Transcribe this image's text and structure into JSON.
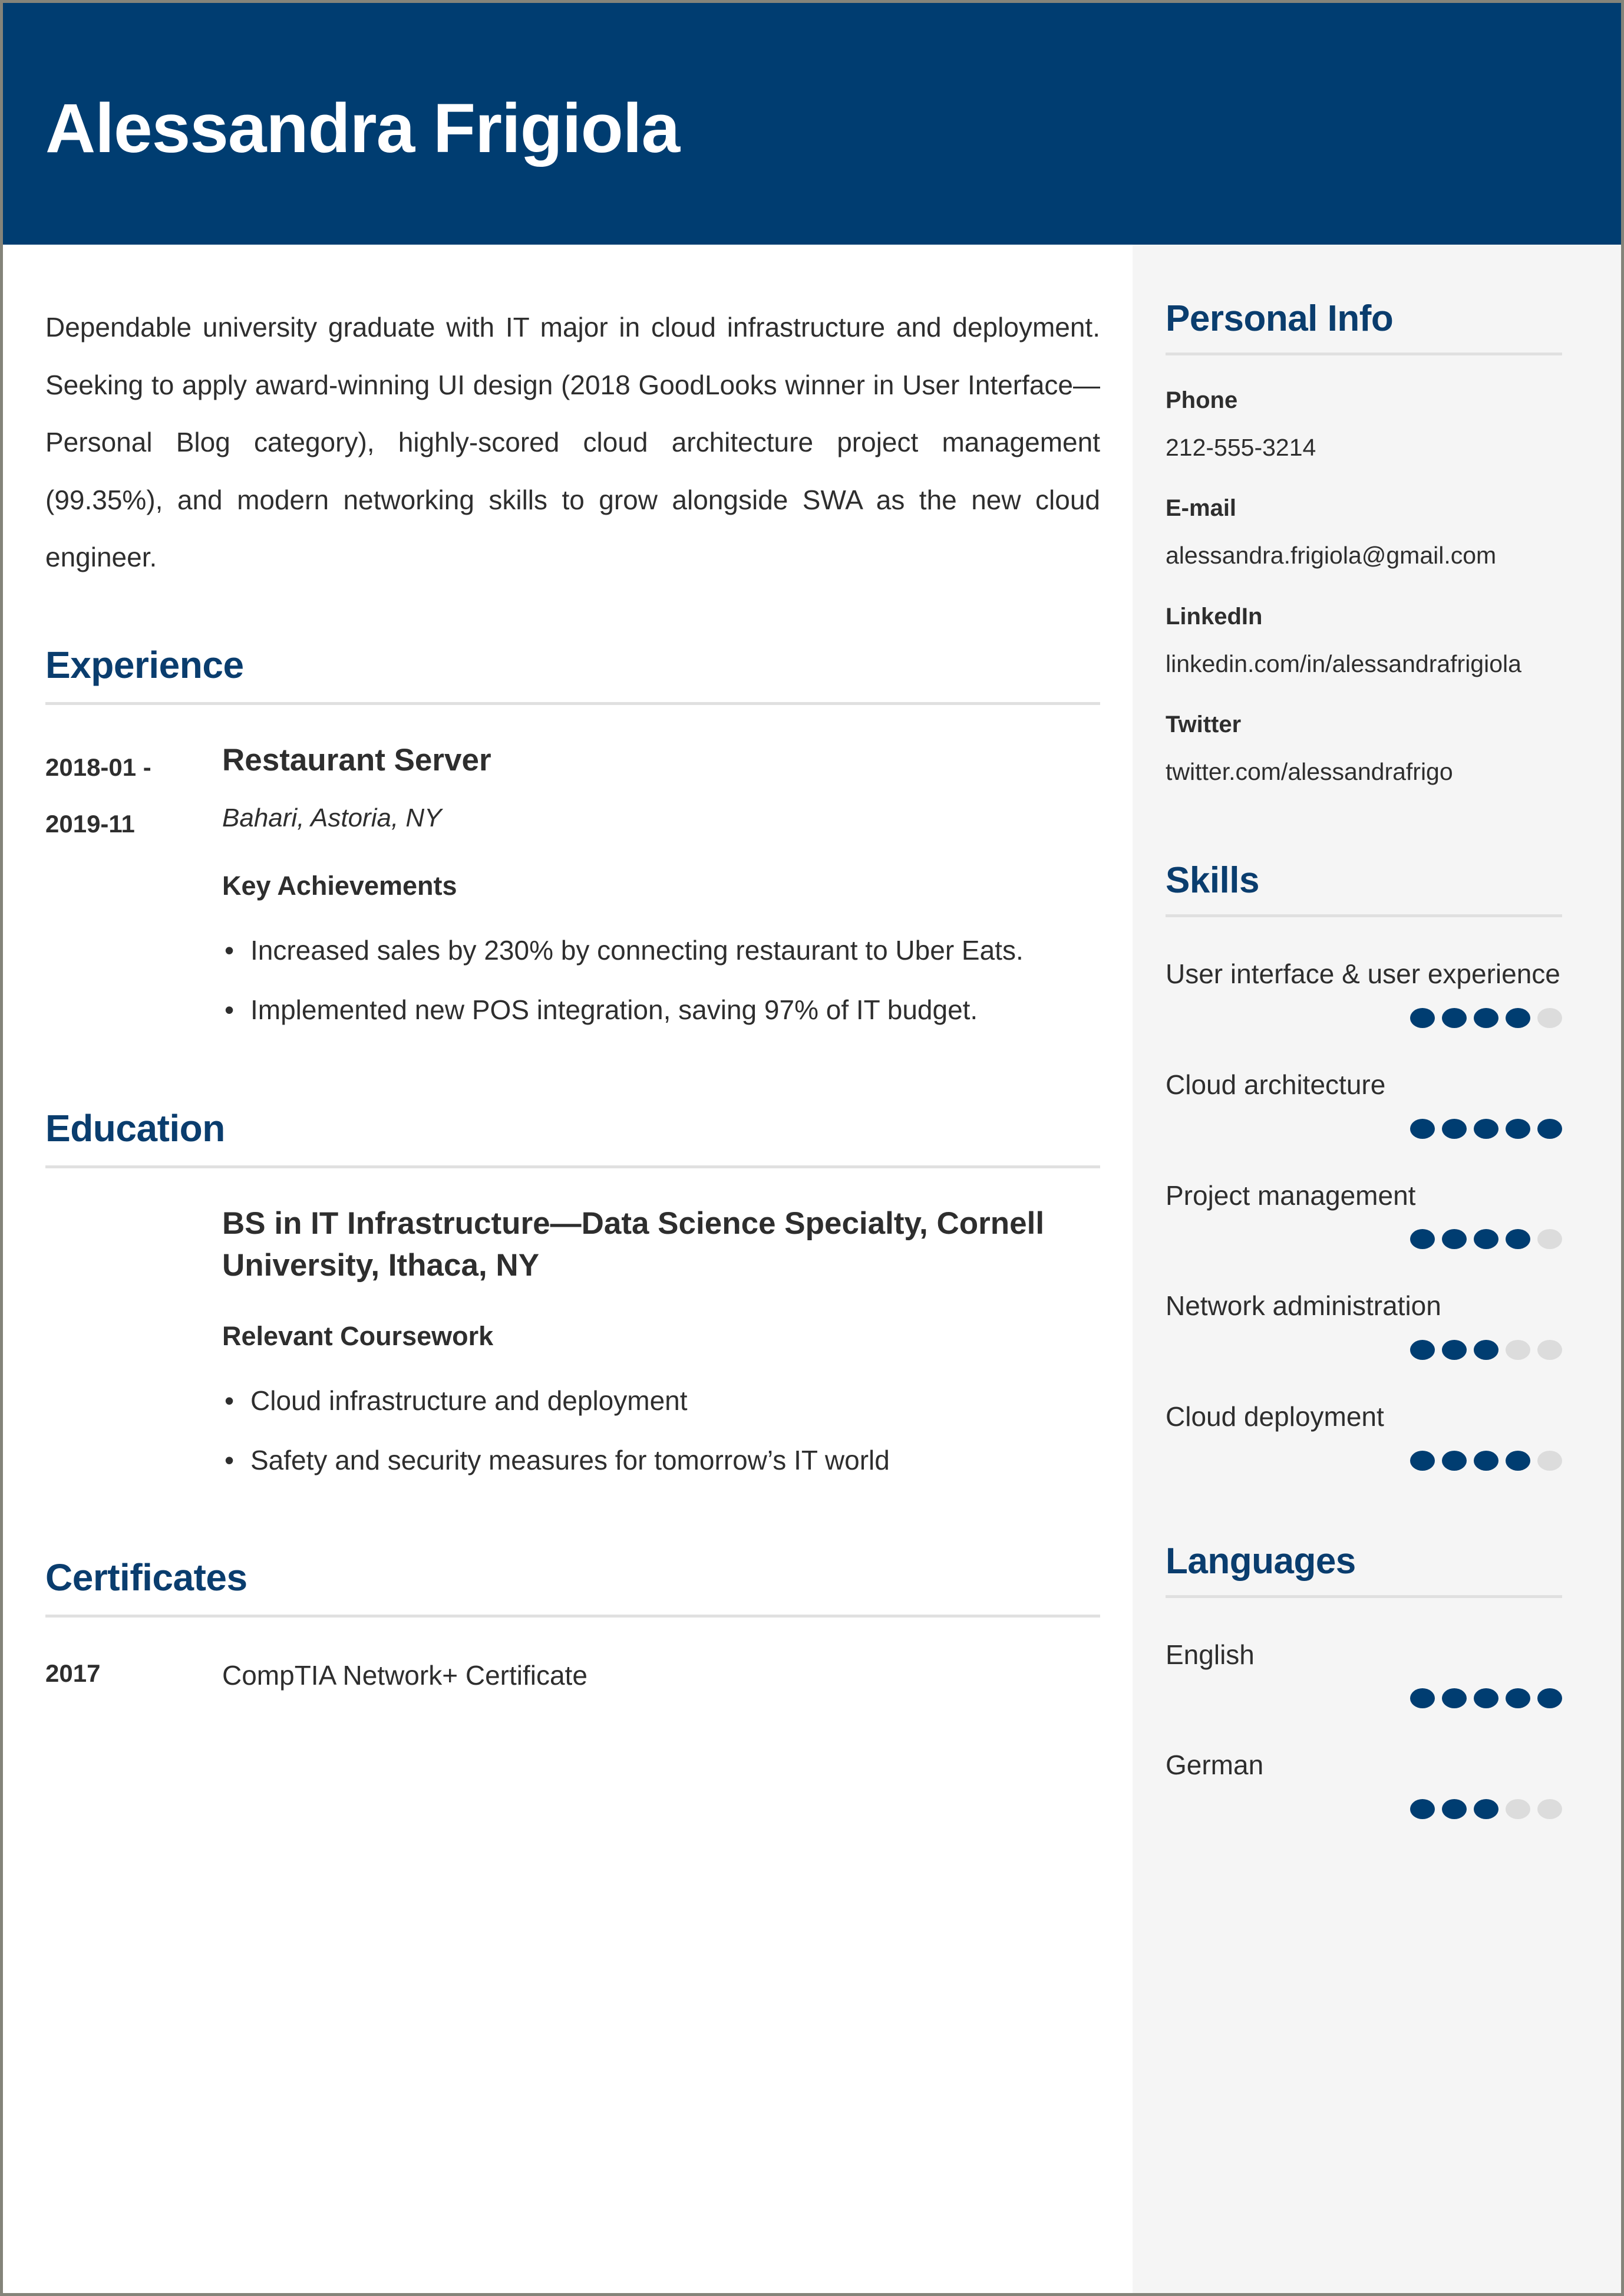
{
  "theme": {
    "header_bg": "#003d71",
    "heading_color": "#0a3d6e",
    "sidebar_bg": "#f5f5f5",
    "text_color": "#2e2e2e",
    "rule_color": "#e0e0e0",
    "dot_on": "#003d71",
    "dot_off": "#dcdcdc",
    "page_border": "#84847a"
  },
  "header": {
    "name": "Alessandra Frigiola"
  },
  "main": {
    "summary": "Dependable university graduate with IT major in cloud infrastructure and deployment. Seeking to apply award-winning UI design (2018 GoodLooks winner in User Interface—Personal Blog category), highly-scored cloud architecture project management (99.35%), and modern networking skills to grow alongside SWA as the new cloud engineer.",
    "experience": {
      "heading": "Experience",
      "entries": [
        {
          "date_line1": "2018-01 -",
          "date_line2": "2019-11",
          "title": "Restaurant Server",
          "subtitle": "Bahari, Astoria, NY",
          "kicker": "Key Achievements",
          "bullets": [
            "Increased sales by 230% by connecting restaurant to Uber Eats.",
            "Implemented new POS integration, saving 97% of IT budget."
          ]
        }
      ]
    },
    "education": {
      "heading": "Education",
      "entries": [
        {
          "title": "BS in IT Infrastructure—Data Science Specialty, Cornell University, Ithaca, NY",
          "kicker": "Relevant Coursework",
          "bullets": [
            "Cloud infrastructure and deployment",
            "Safety and security measures for tomorrow’s IT world"
          ]
        }
      ]
    },
    "certificates": {
      "heading": "Certificates",
      "entries": [
        {
          "year": "2017",
          "name": "CompTIA Network+ Certificate"
        }
      ]
    }
  },
  "sidebar": {
    "personal_info": {
      "heading": "Personal Info",
      "fields": [
        {
          "label": "Phone",
          "value": "212-555-3214"
        },
        {
          "label": "E-mail",
          "value": "alessandra.frigiola@gmail.com"
        },
        {
          "label": "LinkedIn",
          "value": "linkedin.com/in/alessandrafrigiola"
        },
        {
          "label": "Twitter",
          "value": "twitter.com/alessandrafrigo"
        }
      ]
    },
    "skills": {
      "heading": "Skills",
      "max_rating": 5,
      "items": [
        {
          "label": "User interface & user experience",
          "rating": 4
        },
        {
          "label": "Cloud architecture",
          "rating": 5
        },
        {
          "label": "Project management",
          "rating": 4
        },
        {
          "label": "Network administration",
          "rating": 3
        },
        {
          "label": "Cloud deployment",
          "rating": 4
        }
      ]
    },
    "languages": {
      "heading": "Languages",
      "max_rating": 5,
      "items": [
        {
          "label": "English",
          "rating": 5
        },
        {
          "label": "German",
          "rating": 3
        }
      ]
    }
  }
}
